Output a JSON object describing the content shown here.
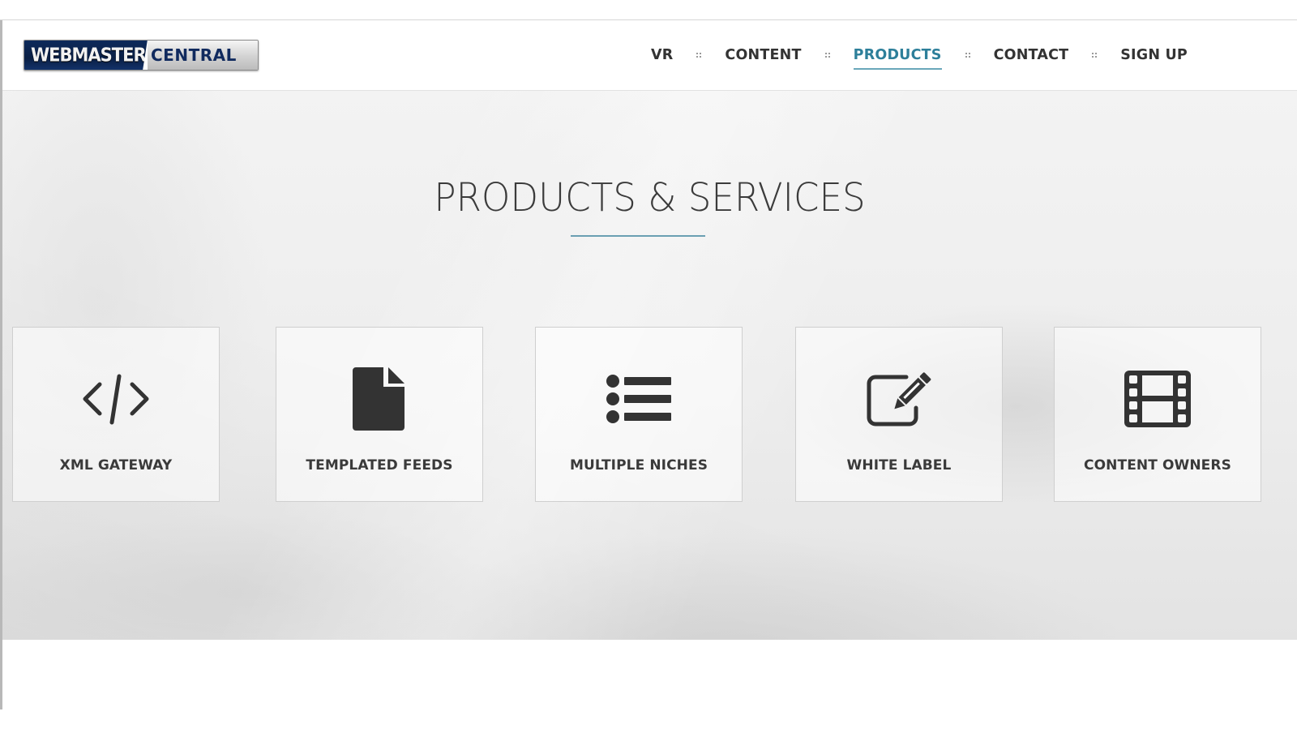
{
  "logo": {
    "left_text": "WEBMASTER",
    "right_text": "CENTRAL"
  },
  "nav": {
    "items": [
      {
        "label": "VR",
        "active": false
      },
      {
        "label": "CONTENT",
        "active": false
      },
      {
        "label": "PRODUCTS",
        "active": true
      },
      {
        "label": "CONTACT",
        "active": false
      },
      {
        "label": "SIGN UP",
        "active": false
      }
    ]
  },
  "hero": {
    "title": "PRODUCTS & SERVICES"
  },
  "cards": [
    {
      "label": "XML GATEWAY",
      "icon": "code-icon"
    },
    {
      "label": "TEMPLATED FEEDS",
      "icon": "file-icon"
    },
    {
      "label": "MULTIPLE NICHES",
      "icon": "list-icon"
    },
    {
      "label": "WHITE LABEL",
      "icon": "edit-icon"
    },
    {
      "label": "CONTENT OWNERS",
      "icon": "film-icon"
    }
  ],
  "colors": {
    "accent": "#2d7f9a",
    "underline": "#6a9fb2",
    "text": "#333333",
    "icon": "#333333"
  }
}
